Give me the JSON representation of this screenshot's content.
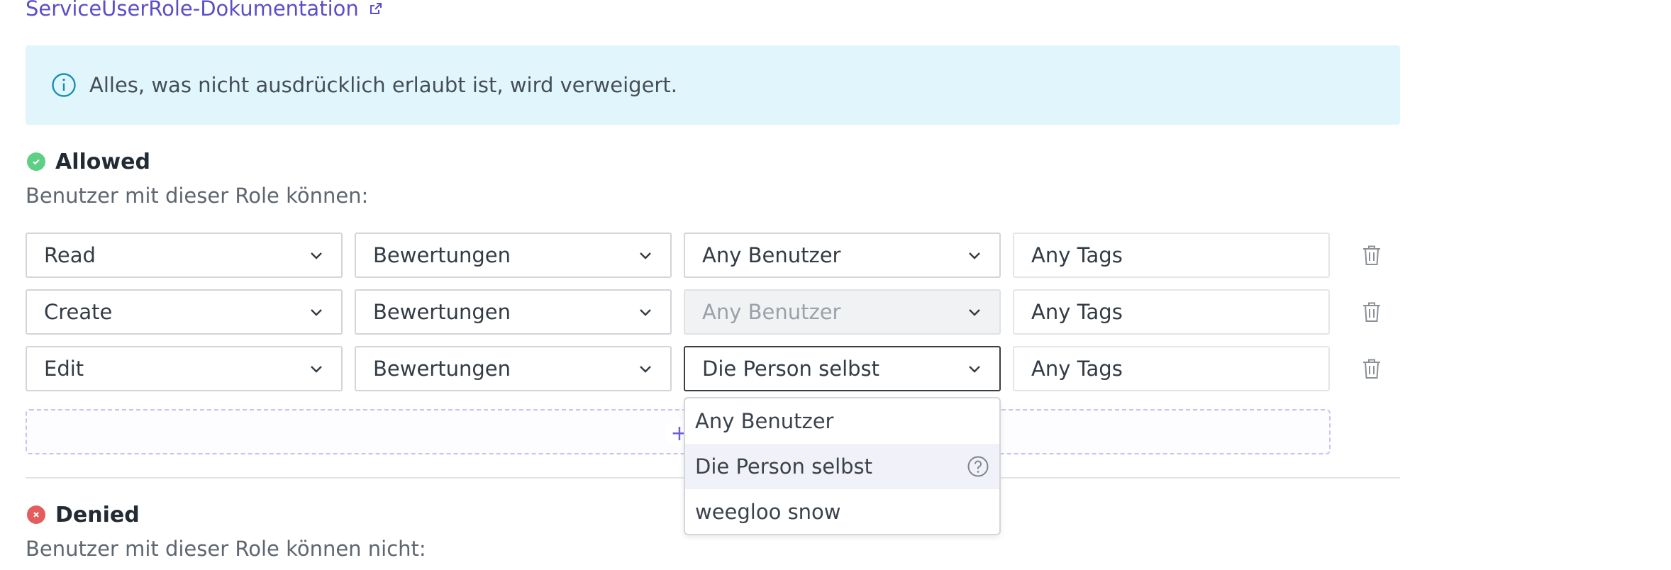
{
  "doc_link": {
    "label": "ServiceUserRole-Dokumentation",
    "icon": "external-link-icon"
  },
  "info_banner": {
    "text": "Alles, was nicht ausdrücklich erlaubt ist, wird verweigert.",
    "icon": "info-icon"
  },
  "allowed": {
    "title": "Allowed",
    "subtitle": "Benutzer mit dieser Role können:",
    "rows": [
      {
        "action": "Read",
        "resource": "Bewertungen",
        "scope": "Any Benutzer",
        "tags": "Any Tags",
        "scope_state": "normal"
      },
      {
        "action": "Create",
        "resource": "Bewertungen",
        "scope": "Any Benutzer",
        "tags": "Any Tags",
        "scope_state": "disabled"
      },
      {
        "action": "Edit",
        "resource": "Bewertungen",
        "scope": "Die Person selbst",
        "tags": "Any Tags",
        "scope_state": "focused"
      }
    ],
    "add_icon": "plus"
  },
  "denied": {
    "title": "Denied",
    "subtitle": "Benutzer mit dieser Role können nicht:"
  },
  "dropdown": {
    "options": [
      {
        "label": "Any Benutzer",
        "highlighted": false,
        "help": false
      },
      {
        "label": "Die Person selbst",
        "highlighted": true,
        "help": true
      },
      {
        "label": "weegloo snow",
        "highlighted": false,
        "help": false
      }
    ]
  },
  "colors": {
    "link": "#5b4fc7",
    "banner_bg": "#e0f6fc",
    "info_accent": "#1b8fb3",
    "allowed_green": "#5fcf86",
    "denied_red": "#e35d5d"
  }
}
